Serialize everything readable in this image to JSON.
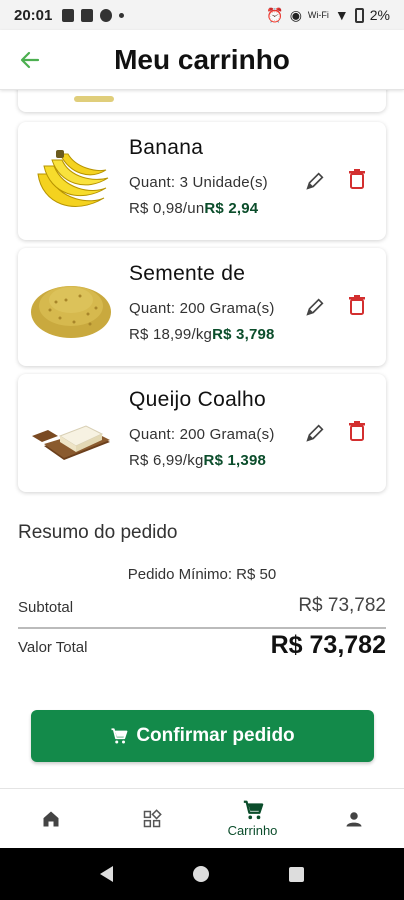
{
  "status_bar": {
    "time": "20:01",
    "signal_text": "Wi-Fi",
    "battery": "2%"
  },
  "header": {
    "title": "Meu carrinho",
    "back_icon": "arrow-left-icon"
  },
  "cart_items": [
    {
      "name": "Banana",
      "quantity": "Quant: 3 Unidade(s)",
      "unit_price": "R$ 0,98/un",
      "total": "R$ 2,94",
      "image": "banana-image"
    },
    {
      "name": "Semente de",
      "quantity": "Quant: 200 Grama(s)",
      "unit_price": "R$ 18,99/kg",
      "total": "R$ 3,798",
      "image": "seeds-image"
    },
    {
      "name": "Queijo Coalho",
      "quantity": "Quant: 200 Grama(s)",
      "unit_price": "R$ 6,99/kg",
      "total": "R$ 1,398",
      "image": "cheese-image"
    }
  ],
  "summary": {
    "title": "Resumo do pedido",
    "min_order": "Pedido Mínimo: R$ 50",
    "subtotal_label": "Subtotal",
    "subtotal_value": "R$ 73,782",
    "total_label": "Valor Total",
    "total_value": "R$ 73,782"
  },
  "confirm_button": {
    "label": "Confirmar pedido",
    "icon": "cart-icon"
  },
  "bottom_nav": {
    "items": [
      {
        "icon": "home-icon",
        "label": ""
      },
      {
        "icon": "categories-icon",
        "label": ""
      },
      {
        "icon": "cart-icon",
        "label": "Carrinho",
        "active": true
      },
      {
        "icon": "profile-icon",
        "label": ""
      }
    ]
  },
  "colors": {
    "accent": "#138a4a",
    "price_green": "#0b4d2b",
    "delete_red": "#d32f2f",
    "back_arrow": "#4caf50"
  }
}
